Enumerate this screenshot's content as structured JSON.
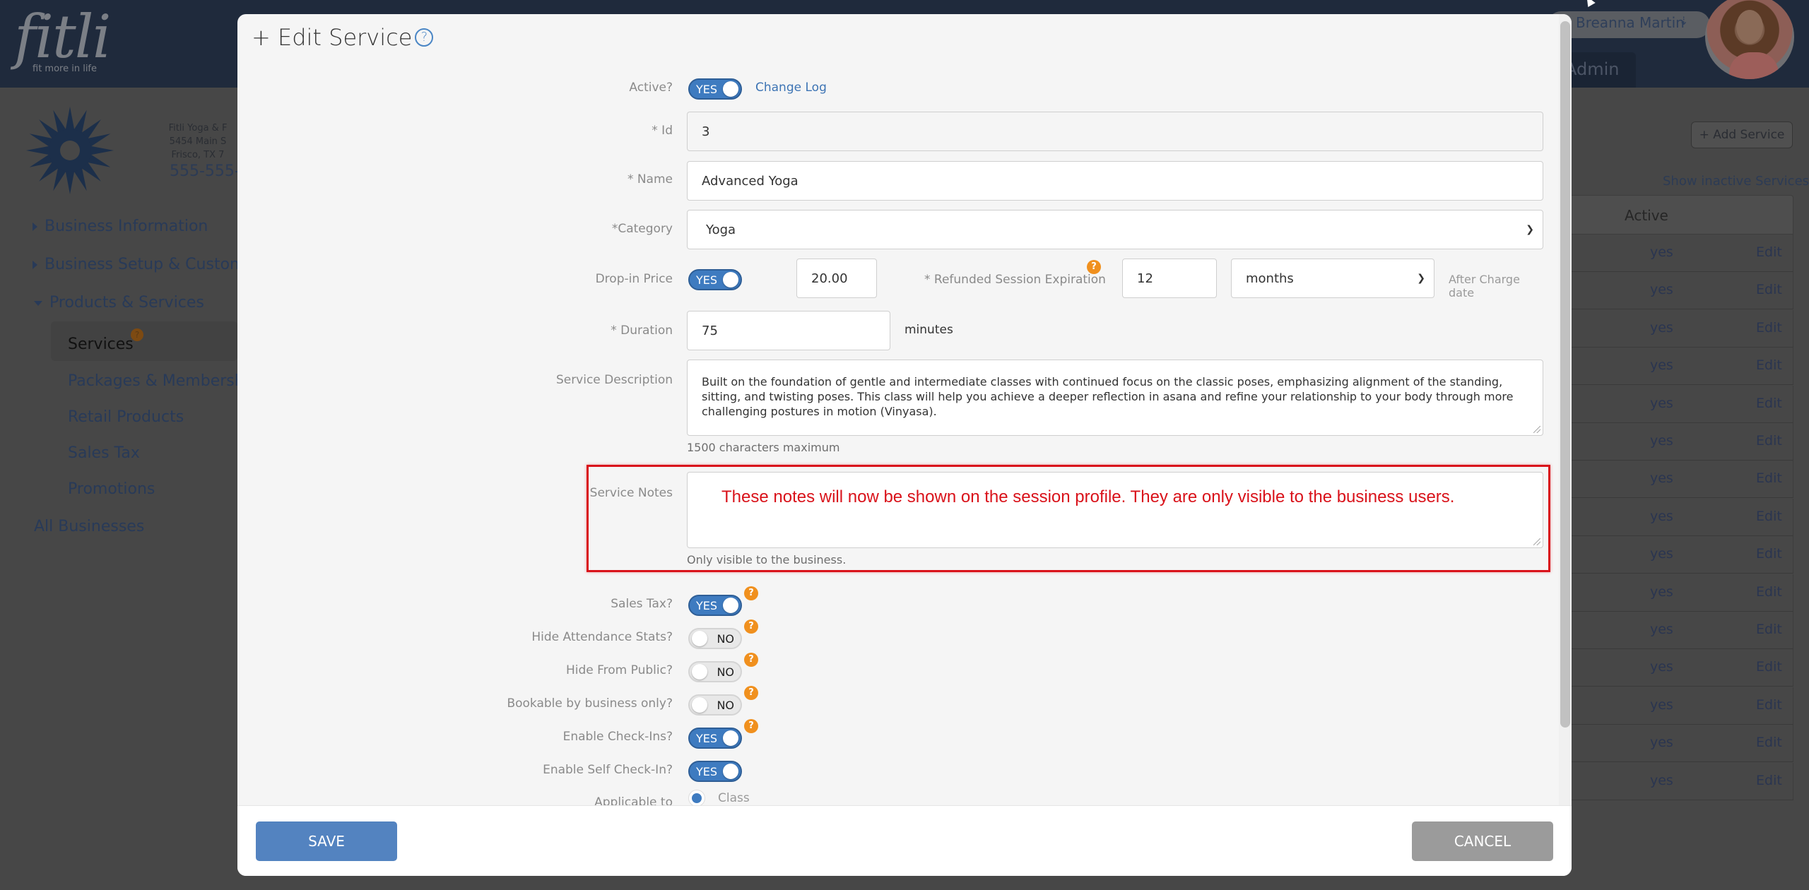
{
  "app": {
    "logo_word": "fitli",
    "logo_tagline": "fit more in life",
    "user_name": "Breanna Martin",
    "admin_tab": "Admin"
  },
  "business": {
    "name": "Fitli Yoga & F",
    "address1": "5454 Main S",
    "address2": "Frisco, TX 7",
    "phone": "555-555-"
  },
  "sidebar": {
    "items": [
      {
        "label": "Business Information",
        "expanded": false
      },
      {
        "label": "Business Setup & Customizati",
        "expanded": false
      },
      {
        "label": "Products & Services",
        "expanded": true
      }
    ],
    "subitems": [
      {
        "label": "Services",
        "active": true
      },
      {
        "label": "Packages & Memberships",
        "active": false
      },
      {
        "label": "Retail Products",
        "active": false
      },
      {
        "label": "Sales Tax",
        "active": false
      },
      {
        "label": "Promotions",
        "active": false
      }
    ],
    "all_businesses": "All Businesses",
    "badge": "?"
  },
  "services_page": {
    "add_button": "+ Add Service",
    "show_inactive": "Show inactive Services",
    "table_header_active": "Active",
    "rows": [
      {
        "active": "yes",
        "action": "Edit"
      },
      {
        "active": "yes",
        "action": "Edit"
      },
      {
        "active": "yes",
        "action": "Edit"
      },
      {
        "active": "yes",
        "action": "Edit"
      },
      {
        "active": "yes",
        "action": "Edit"
      },
      {
        "active": "yes",
        "action": "Edit"
      },
      {
        "active": "yes",
        "action": "Edit"
      },
      {
        "active": "yes",
        "action": "Edit"
      },
      {
        "active": "yes",
        "action": "Edit"
      },
      {
        "active": "yes",
        "action": "Edit"
      },
      {
        "active": "yes",
        "action": "Edit"
      },
      {
        "active": "yes",
        "action": "Edit"
      },
      {
        "active": "yes",
        "action": "Edit"
      },
      {
        "active": "yes",
        "action": "Edit"
      },
      {
        "active": "yes",
        "action": "Edit"
      }
    ]
  },
  "modal": {
    "title": "+ Edit Service",
    "help": "?",
    "active_label": "Active?",
    "active_value": "YES",
    "change_log": "Change Log",
    "id_label": "* Id",
    "id_value": "3",
    "name_label": "* Name",
    "name_value": "Advanced Yoga",
    "category_label": "*Category",
    "category_value": "Yoga",
    "dropin_label": "Drop-in Price",
    "dropin_toggle": "YES",
    "dropin_value": "20.00",
    "refund_label": "* Refunded Session Expiration",
    "refund_value": "12",
    "refund_unit": "months",
    "refund_suffix_line1": "After Charge",
    "refund_suffix_line2": "date",
    "duration_label": "* Duration",
    "duration_value": "75",
    "duration_unit": "minutes",
    "description_label": "Service Description",
    "description_value": "Built on the foundation of gentle and intermediate classes with continued focus on the classic poses, emphasizing alignment of the standing, sitting, and twisting poses. This class will help you achieve a deeper reflection in asana and refine your relationship to your body through more challenging postures in motion (Vinyasa).",
    "description_hint": "1500 characters maximum",
    "notes_label": "Service Notes",
    "notes_value": "These notes will now be shown on the session profile.  They are only visible to the business users.",
    "notes_hint": "Only visible to the business.",
    "toggles": [
      {
        "label": "Sales Tax?",
        "value": "YES",
        "on": true,
        "help": true
      },
      {
        "label": "Hide Attendance Stats?",
        "value": "NO",
        "on": false,
        "help": true
      },
      {
        "label": "Hide From Public?",
        "value": "NO",
        "on": false,
        "help": true
      },
      {
        "label": "Bookable by business only?",
        "value": "NO",
        "on": false,
        "help": true
      },
      {
        "label": "Enable Check-Ins?",
        "value": "YES",
        "on": true,
        "help": true
      },
      {
        "label": "Enable Self Check-In?",
        "value": "YES",
        "on": true,
        "help": false
      }
    ],
    "applicable_label": "Applicable to",
    "applicable_option": "Class",
    "save": "SAVE",
    "cancel": "CANCEL"
  },
  "colors": {
    "accent": "#3e7bc0",
    "annotation": "#d9121a",
    "help_badge": "#f0901e",
    "topbar": "#1f2a3c"
  }
}
